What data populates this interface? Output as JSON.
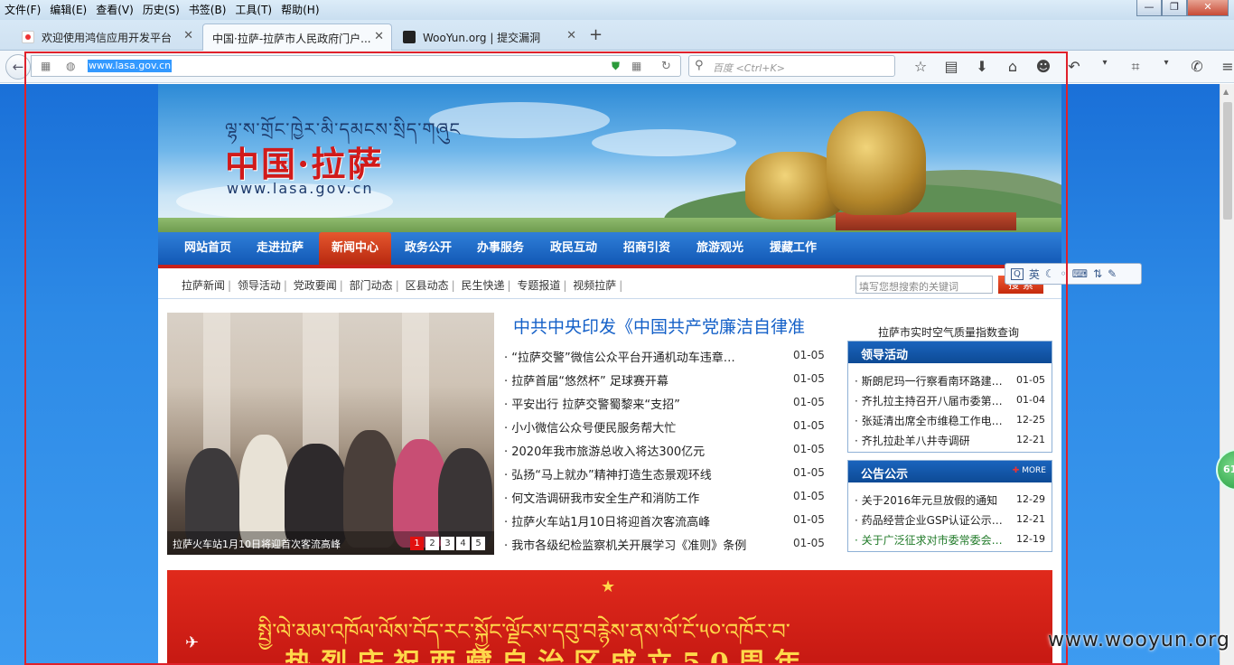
{
  "menubar": [
    "文件(F)",
    "编辑(E)",
    "查看(V)",
    "历史(S)",
    "书签(B)",
    "工具(T)",
    "帮助(H)"
  ],
  "window_controls": {
    "minimize": "—",
    "maximize": "❐",
    "close": "✕"
  },
  "tabs": [
    {
      "label": "欢迎使用鸿信应用开发平台",
      "close": "✕"
    },
    {
      "label": "中国·拉萨-拉萨市人民政府门户...",
      "close": "✕"
    },
    {
      "label": "WooYun.org | 提交漏洞",
      "close": "✕"
    }
  ],
  "new_tab": "+",
  "urlbar": {
    "value": "www.lasa.gov.cn"
  },
  "search": {
    "placeholder": "百度 <Ctrl+K>"
  },
  "site": {
    "tibetan": "ལྷ་ས་གྲོང་ཁྱེར་མི་དམངས་སྲིད་གཞུང",
    "name": "中国·拉萨",
    "url": "www.lasa.gov.cn",
    "nav": [
      "网站首页",
      "走进拉萨",
      "新闻中心",
      "政务公开",
      "办事服务",
      "政民互动",
      "招商引资",
      "旅游观光",
      "援藏工作"
    ],
    "subnav": [
      "拉萨新闻",
      "领导活动",
      "党政要闻",
      "部门动态",
      "区县动态",
      "民生快递",
      "专题报道",
      "视频拉萨"
    ],
    "keyword_placeholder": "填写您想搜索的关键词",
    "search_btn": "搜 索",
    "photo_caption": "拉萨火车站1月10日将迎首次客流高峰",
    "pager": [
      "1",
      "2",
      "3",
      "4",
      "5"
    ],
    "headline": "中共中央印发《中国共产党廉洁自律准",
    "news": [
      {
        "title": "“拉萨交警”微信公众平台开通机动车违章…",
        "date": "01-05"
      },
      {
        "title": "拉萨首届“悠然杯” 足球赛开幕",
        "date": "01-05"
      },
      {
        "title": "平安出行 拉萨交警蜀黎来“支招”",
        "date": "01-05"
      },
      {
        "title": "小小微信公众号便民服务帮大忙",
        "date": "01-05"
      },
      {
        "title": "2020年我市旅游总收入将达300亿元",
        "date": "01-05"
      },
      {
        "title": "弘扬“马上就办”精神打造生态景观环线",
        "date": "01-05"
      },
      {
        "title": "何文浩调研我市安全生产和消防工作",
        "date": "01-05"
      },
      {
        "title": "拉萨火车站1月10日将迎首次客流高峰",
        "date": "01-05"
      },
      {
        "title": "我市各级纪检监察机关开展学习《准则》条例",
        "date": "01-05"
      }
    ],
    "aqi_link": "拉萨市实时空气质量指数查询",
    "leaders": {
      "title": "领导活动",
      "items": [
        {
          "title": "斯朗尼玛一行察看南环路建…",
          "date": "01-05"
        },
        {
          "title": "齐扎拉主持召开八届市委第…",
          "date": "01-04"
        },
        {
          "title": "张延清出席全市维稳工作电…",
          "date": "12-25"
        },
        {
          "title": "齐扎拉赴羊八井寺调研",
          "date": "12-21"
        }
      ]
    },
    "notices": {
      "title": "公告公示",
      "more": "MORE",
      "items": [
        {
          "title": "关于2016年元旦放假的通知",
          "date": "12-29"
        },
        {
          "title": "药品经营企业GSP认证公示…",
          "date": "12-21"
        },
        {
          "title": "关于广泛征求对市委常委会…",
          "date": "12-19"
        }
      ]
    },
    "red_banner_tibetan": "སྤྱི་ལེ་མམ་འཁོལ་ལོས་བོད་རང་སྐྱོང་ལྗོངས་དབུ་བརྙེས་ནས་ལོ་ངོ་༥༠་འཁོར་བ་",
    "red_banner_zh": "热烈庆祝西藏自治区成立50周年"
  },
  "ime": {
    "lang": "英"
  },
  "badge": "61",
  "watermark": "www.wooyun.org",
  "colors": {
    "nav_blue": "#1258b5",
    "accent_red": "#c8221b",
    "headline_blue": "#1460c8",
    "frame_red": "#e0212a"
  }
}
